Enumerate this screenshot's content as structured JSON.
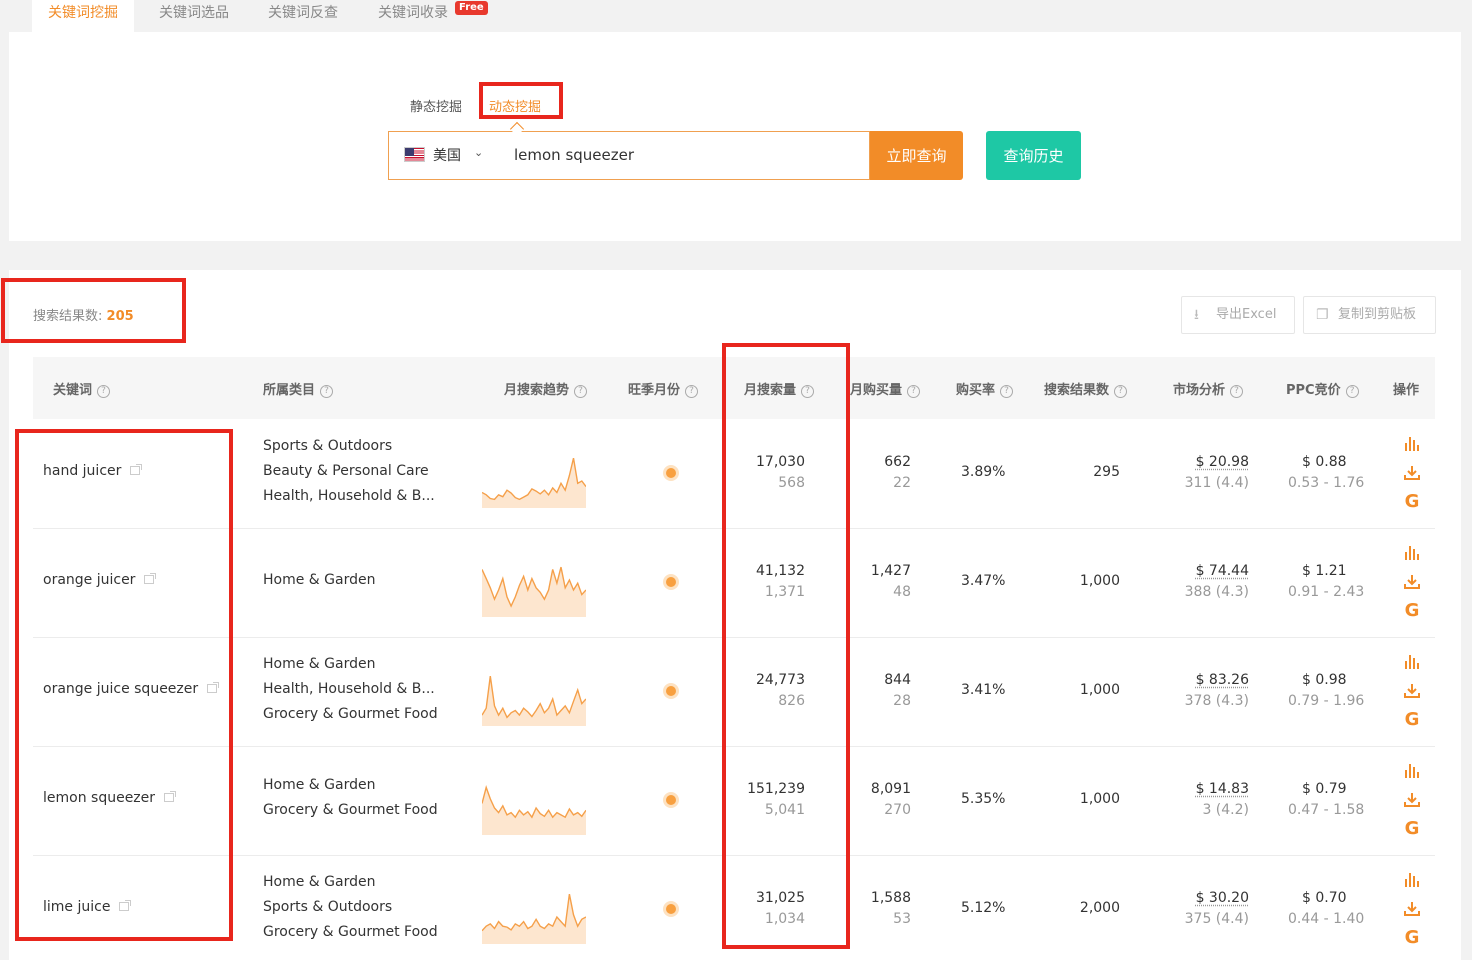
{
  "tabs": [
    {
      "label": "关键词挖掘",
      "active": true
    },
    {
      "label": "关键词选品",
      "active": false
    },
    {
      "label": "关键词反查",
      "active": false
    },
    {
      "label": "关键词收录",
      "active": false
    }
  ],
  "free_badge": "Free",
  "modes": {
    "static": "静态挖掘",
    "dynamic": "动态挖掘",
    "active": "dynamic"
  },
  "search": {
    "country": "美国",
    "query": "lemon squeezer",
    "query_button": "立即查询",
    "history_button": "查询历史"
  },
  "results": {
    "count_label": "搜索结果数:",
    "count": "205",
    "export_label": "导出Excel",
    "copy_label": "复制到剪贴板"
  },
  "columns": [
    "关键词",
    "所属类目",
    "月搜索趋势",
    "旺季月份",
    "月搜索量",
    "月购买量",
    "购买率",
    "搜索结果数",
    "市场分析",
    "PPC竞价",
    "操作"
  ],
  "rows": [
    {
      "keyword": "hand juicer",
      "categories": [
        "Sports & Outdoors",
        "Beauty & Personal Care",
        "Health, Household & B..."
      ],
      "trend": [
        0.25,
        0.2,
        0.12,
        0.1,
        0.2,
        0.16,
        0.3,
        0.24,
        0.14,
        0.1,
        0.15,
        0.2,
        0.33,
        0.28,
        0.22,
        0.3,
        0.2,
        0.35,
        0.25,
        0.45,
        0.3,
        0.62,
        1.0,
        0.45,
        0.5,
        0.38
      ],
      "monthly_search": "17,030",
      "monthly_search_sub": "568",
      "monthly_buy": "662",
      "monthly_buy_sub": "22",
      "buy_rate": "3.89%",
      "search_results": "295",
      "market": "$ 20.98",
      "market_sub": "311 (4.4)",
      "ppc": "$ 0.88",
      "ppc_range": "0.53 - 1.76"
    },
    {
      "keyword": "orange juicer",
      "categories": [
        "Home & Garden"
      ],
      "trend": [
        0.95,
        0.75,
        0.55,
        0.3,
        0.5,
        0.75,
        0.35,
        0.15,
        0.35,
        0.6,
        0.8,
        0.5,
        0.75,
        0.55,
        0.45,
        0.3,
        0.5,
        0.95,
        0.65,
        1.0,
        0.55,
        0.72,
        0.5,
        0.65,
        0.4,
        0.5
      ],
      "monthly_search": "41,132",
      "monthly_search_sub": "1,371",
      "monthly_buy": "1,427",
      "monthly_buy_sub": "48",
      "buy_rate": "3.47%",
      "search_results": "1,000",
      "market": "$ 74.44",
      "market_sub": "388 (4.3)",
      "ppc": "$ 1.21",
      "ppc_range": "0.91 - 2.43"
    },
    {
      "keyword": "orange juice squeezer",
      "categories": [
        "Home & Garden",
        "Health, Household & B...",
        "Grocery & Gourmet Food"
      ],
      "trend": [
        0.15,
        0.3,
        1.0,
        0.35,
        0.15,
        0.3,
        0.1,
        0.2,
        0.25,
        0.15,
        0.3,
        0.22,
        0.12,
        0.25,
        0.4,
        0.2,
        0.3,
        0.5,
        0.15,
        0.25,
        0.35,
        0.2,
        0.45,
        0.7,
        0.4,
        0.5
      ],
      "monthly_search": "24,773",
      "monthly_search_sub": "826",
      "monthly_buy": "844",
      "monthly_buy_sub": "28",
      "buy_rate": "3.41%",
      "search_results": "1,000",
      "market": "$ 83.26",
      "market_sub": "378 (4.3)",
      "ppc": "$ 0.98",
      "ppc_range": "0.79 - 1.96"
    },
    {
      "keyword": "lemon squeezer",
      "categories": [
        "Home & Garden",
        "Grocery & Gourmet Food"
      ],
      "trend": [
        0.6,
        0.95,
        0.7,
        0.5,
        0.4,
        0.55,
        0.35,
        0.4,
        0.3,
        0.45,
        0.35,
        0.42,
        0.3,
        0.5,
        0.38,
        0.32,
        0.45,
        0.3,
        0.4,
        0.35,
        0.3,
        0.48,
        0.35,
        0.4,
        0.32,
        0.45
      ],
      "monthly_search": "151,239",
      "monthly_search_sub": "5,041",
      "monthly_buy": "8,091",
      "monthly_buy_sub": "270",
      "buy_rate": "5.35%",
      "search_results": "1,000",
      "market": "$ 14.83",
      "market_sub": "3 (4.2)",
      "ppc": "$ 0.79",
      "ppc_range": "0.47 - 1.58"
    },
    {
      "keyword": "lime juice",
      "categories": [
        "Home & Garden",
        "Sports & Outdoors",
        "Grocery & Gourmet Food"
      ],
      "trend": [
        0.2,
        0.3,
        0.35,
        0.25,
        0.4,
        0.3,
        0.28,
        0.22,
        0.35,
        0.3,
        0.4,
        0.25,
        0.3,
        0.45,
        0.3,
        0.25,
        0.35,
        0.3,
        0.5,
        0.4,
        0.3,
        1.0,
        0.55,
        0.3,
        0.45,
        0.5
      ],
      "monthly_search": "31,025",
      "monthly_search_sub": "1,034",
      "monthly_buy": "1,588",
      "monthly_buy_sub": "53",
      "buy_rate": "5.12%",
      "search_results": "2,000",
      "market": "$ 30.20",
      "market_sub": "375 (4.4)",
      "ppc": "$ 0.70",
      "ppc_range": "0.44 - 1.40"
    }
  ],
  "colors": {
    "accent": "#f28c28",
    "teal": "#1ec8a5",
    "highlight": "#e8261d"
  }
}
